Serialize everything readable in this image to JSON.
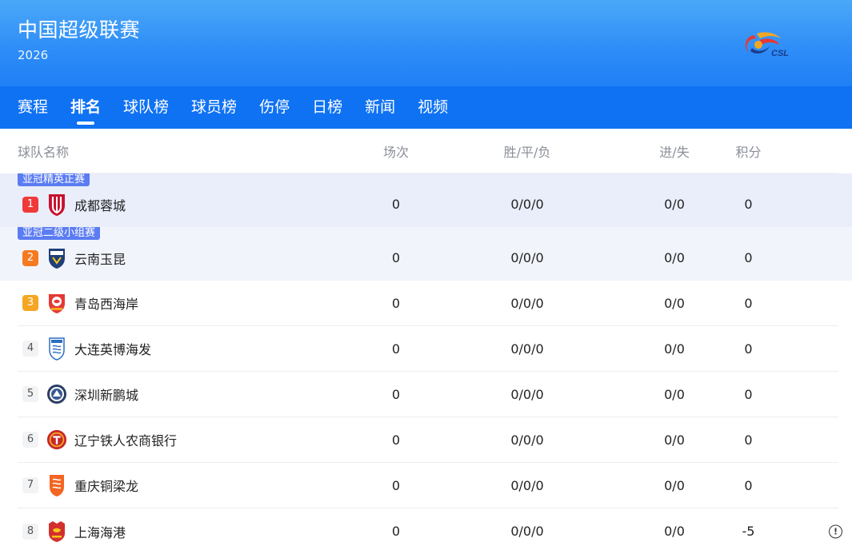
{
  "header": {
    "title": "中国超级联赛",
    "season": "2026",
    "logo_text": "CSL"
  },
  "nav": {
    "items": [
      "赛程",
      "排名",
      "球队榜",
      "球员榜",
      "伤停",
      "日榜",
      "新闻",
      "视频"
    ],
    "active": "排名"
  },
  "table": {
    "columns": {
      "team": "球队名称",
      "played": "场次",
      "wdl": "胜/平/负",
      "gf_ga": "进/失",
      "points": "积分"
    },
    "zones": {
      "afc_elite": "亚冠精英正赛",
      "afc_two": "亚冠二级小组赛"
    },
    "rows": [
      {
        "rank": "1",
        "team": "成都蓉城",
        "played": "0",
        "wdl": "0/0/0",
        "gf_ga": "0/0",
        "points": "0",
        "badge": "chengdu-badge-icon"
      },
      {
        "rank": "2",
        "team": "云南玉昆",
        "played": "0",
        "wdl": "0/0/0",
        "gf_ga": "0/0",
        "points": "0",
        "badge": "yunnan-badge-icon"
      },
      {
        "rank": "3",
        "team": "青岛西海岸",
        "played": "0",
        "wdl": "0/0/0",
        "gf_ga": "0/0",
        "points": "0",
        "badge": "qingdao-badge-icon"
      },
      {
        "rank": "4",
        "team": "大连英博海发",
        "played": "0",
        "wdl": "0/0/0",
        "gf_ga": "0/0",
        "points": "0",
        "badge": "dalian-badge-icon"
      },
      {
        "rank": "5",
        "team": "深圳新鹏城",
        "played": "0",
        "wdl": "0/0/0",
        "gf_ga": "0/0",
        "points": "0",
        "badge": "shenzhen-badge-icon"
      },
      {
        "rank": "6",
        "team": "辽宁铁人农商银行",
        "played": "0",
        "wdl": "0/0/0",
        "gf_ga": "0/0",
        "points": "0",
        "badge": "liaoning-badge-icon"
      },
      {
        "rank": "7",
        "team": "重庆铜梁龙",
        "played": "0",
        "wdl": "0/0/0",
        "gf_ga": "0/0",
        "points": "0",
        "badge": "chongqing-badge-icon"
      },
      {
        "rank": "8",
        "team": "上海海港",
        "played": "0",
        "wdl": "0/0/0",
        "gf_ga": "0/0",
        "points": "-5",
        "badge": "shanghai-badge-icon"
      }
    ]
  },
  "colors": {
    "header_blue": "#2d8cf7",
    "nav_blue": "#0f72f3",
    "zone_tag": "#5b7cf2",
    "rank1": "#f03a3a",
    "rank2": "#f57a20",
    "rank3": "#f5a623"
  }
}
